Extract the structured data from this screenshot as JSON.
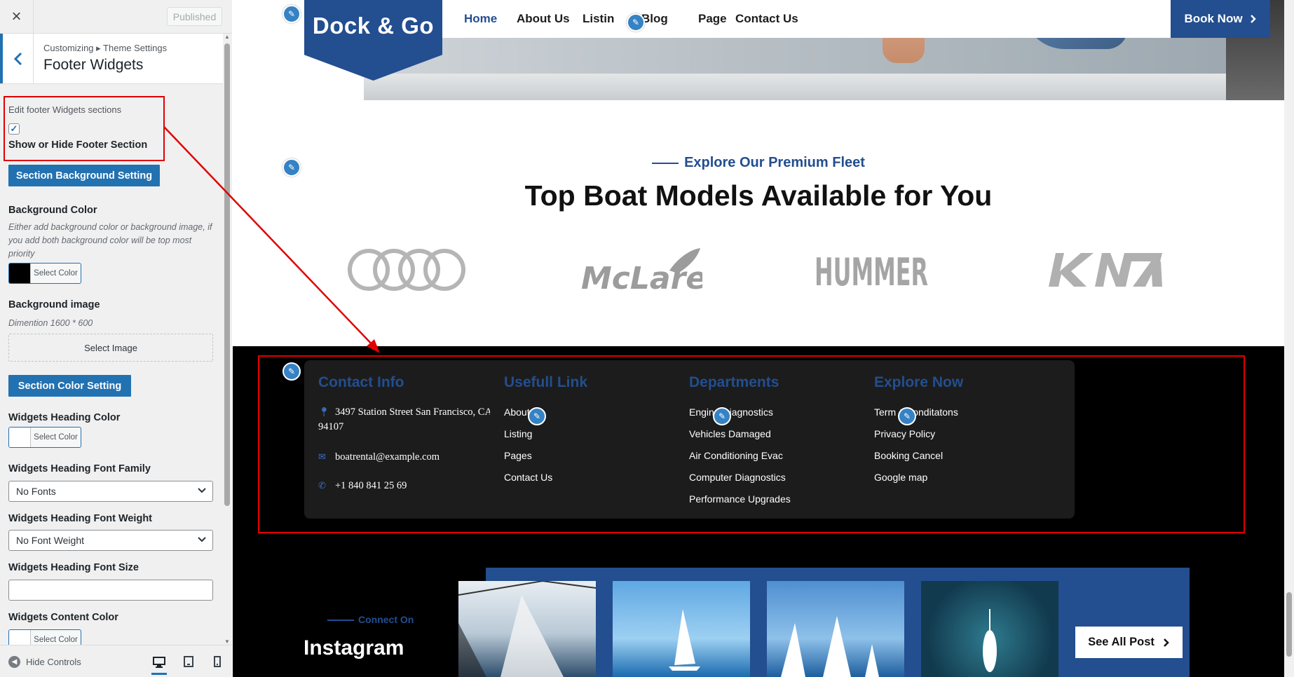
{
  "sidebar": {
    "close_icon": "×",
    "published_label": "Published",
    "breadcrumb": "Customizing ▸ Theme Settings",
    "panel_title": "Footer Widgets",
    "edit_label": "Edit footer Widgets sections",
    "checkbox_checked": true,
    "show_hide_label": "Show or Hide Footer Section",
    "bg_setting_button": "Section Background Setting",
    "bg_color_label": "Background Color",
    "bg_color_help": "Either add background color or background image, if you add both background color will be top most priority",
    "select_color": "Select Color",
    "bg_color_value": "#000000",
    "bg_image_label": "Background image",
    "bg_image_dimension": "Dimention 1600 * 600",
    "select_image": "Select Image",
    "color_setting_button": "Section Color Setting",
    "heading_color_label": "Widgets Heading Color",
    "heading_font_family_label": "Widgets Heading Font Family",
    "heading_font_family_value": "No Fonts",
    "heading_font_weight_label": "Widgets Heading Font Weight",
    "heading_font_weight_value": "No Font Weight",
    "heading_font_size_label": "Widgets Heading Font Size",
    "heading_font_size_value": "",
    "content_color_label": "Widgets Content Color",
    "hide_controls": "Hide Controls"
  },
  "site": {
    "logo": "Dock & Go",
    "nav": [
      "Home",
      "About Us",
      "Listin",
      "Blog",
      "Page",
      "Contact Us"
    ],
    "book_now": "Book Now",
    "accent_color": "#234e8f",
    "fleet_subtitle": "Explore Our Premium Fleet",
    "fleet_title": "Top Boat Models Available for You",
    "brands": [
      "audi",
      "McLaren",
      "HUMMER",
      "KIA"
    ],
    "footer": {
      "contact": {
        "title": "Contact Info",
        "address": "3497 Station Street San Francisco, CA 94107",
        "email": "boatrental@example.com",
        "phone": "+1 840 841 25 69"
      },
      "useful": {
        "title": "Usefull Link",
        "links": [
          "About Us",
          "Listing",
          "Pages",
          "Contact Us"
        ]
      },
      "departments": {
        "title": "Departments",
        "links": [
          "Engine Diagnostics",
          "Vehicles Damaged",
          "Air Conditioning Evac",
          "Computer Diagnostics",
          "Performance Upgrades"
        ]
      },
      "explore": {
        "title": "Explore Now",
        "links": [
          "Term & conditatons",
          "Privacy Policy",
          "Booking Cancel",
          "Google map"
        ]
      }
    },
    "instagram": {
      "connect": "Connect On",
      "title": "Instagram",
      "see_all": "See All Post"
    }
  }
}
